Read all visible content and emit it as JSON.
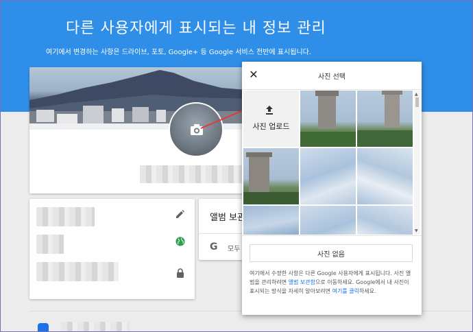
{
  "hero": {
    "title": "다른 사용자에게 표시되는 내 정보 관리",
    "subtitle": "여기에서 변경하는 사항은 드라이브, 포토, Google+ 등 Google 서비스 전반에 표시됩니다."
  },
  "album_card": {
    "title": "앨범 보관함",
    "more_label": "모두 보기"
  },
  "dialog": {
    "close_icon": "close-icon",
    "title": "사진 선택",
    "upload_label": "사진 업로드",
    "no_photo_button": "사진 없음",
    "note_part1": "여기에서 수정한 사항은 다른 Google 사용자에게 표시됩니다. 사진 앨범을 관리하려면 ",
    "note_link1": "앨범 보관함",
    "note_part2": "으로 이동하세요. Google에서 내 사진이 표시되는 방식을 자세히 알아보려면 ",
    "note_link2": "여기를 클릭",
    "note_part3": "하세요."
  },
  "colors": {
    "hero_blue": "#2f8fe8",
    "link_blue": "#1a73e8",
    "arrow_red": "#e53935",
    "globe_green": "#2e9e4f"
  }
}
